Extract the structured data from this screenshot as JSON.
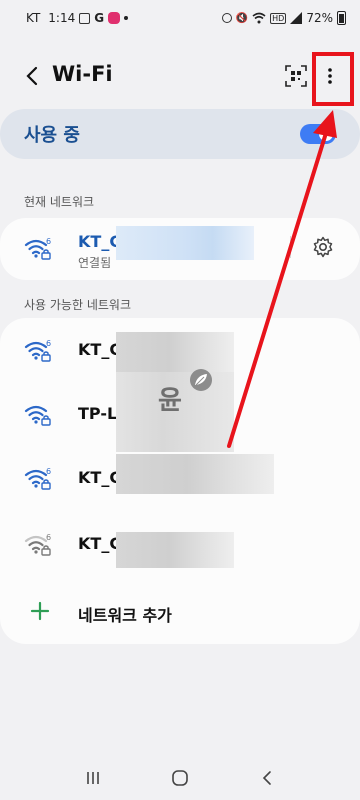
{
  "status_bar": {
    "carrier": "KT",
    "time": "1:14",
    "notification_icons": [
      "gallery-icon",
      "google-icon",
      "instagram-icon"
    ],
    "status_icons": [
      "alarm-icon",
      "mute-icon",
      "wifi-icon",
      "hd-icon",
      "signal-icon"
    ],
    "battery": "72%"
  },
  "header": {
    "back_icon": "back-arrow-icon",
    "title": "Wi-Fi",
    "qr_icon": "qr-scanner-icon",
    "more_icon": "more-vertical-icon"
  },
  "master_toggle": {
    "label": "사용 중",
    "on": true
  },
  "current_network": {
    "section_title": "현재 네트워크",
    "name": "KT_C",
    "status": "연결됨",
    "wifi_generation": "6",
    "settings_icon": "gear-icon"
  },
  "available_networks": {
    "section_title": "사용 가능한 네트워크",
    "items": [
      {
        "name": "KT_C",
        "wifi_generation": "6",
        "locked": true,
        "signal": "strong"
      },
      {
        "name": "TP-L",
        "wifi_generation": "",
        "locked": true,
        "signal": "strong"
      },
      {
        "name": "KT_C",
        "wifi_generation": "6",
        "locked": true,
        "signal": "strong"
      },
      {
        "name": "KT_C",
        "wifi_generation": "6",
        "locked": true,
        "signal": "weak"
      }
    ],
    "add_label": "네트워크 추가"
  },
  "watermark": {
    "text": "윤"
  },
  "annotation": {
    "color": "#e8141c"
  },
  "colors": {
    "accent": "#3e7cf4",
    "connected_text": "#1c5bb0",
    "toggle_bg": "#dfe4ec",
    "add_plus": "#2e9e55"
  },
  "nav_bar": {
    "recents_icon": "recents-icon",
    "home_icon": "home-icon",
    "back_icon": "back-icon"
  }
}
